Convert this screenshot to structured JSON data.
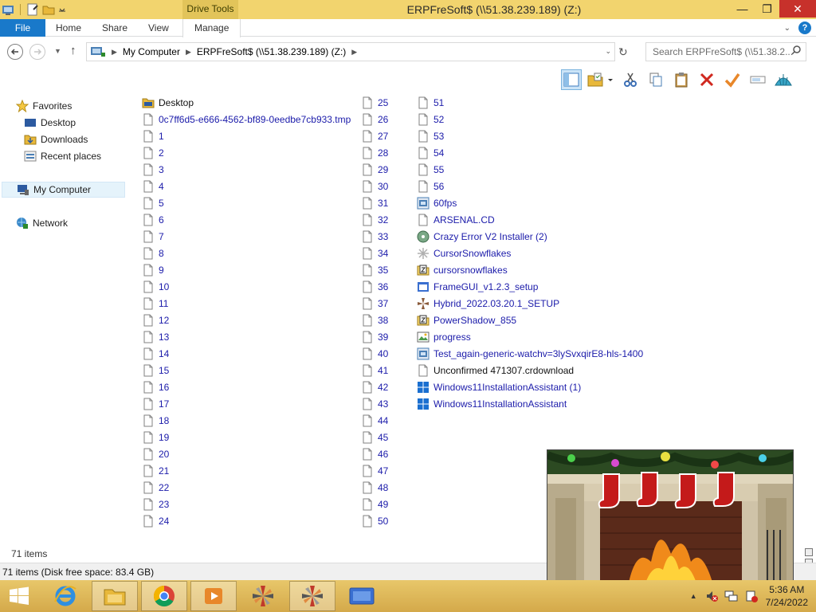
{
  "window": {
    "title": "ERPFreSoft$ (\\\\51.38.239.189) (Z:)",
    "context_tab": "Drive Tools",
    "controls": {
      "minimize": "—",
      "maximize": "❐",
      "close": "✕"
    }
  },
  "ribbon": {
    "tabs": [
      "File",
      "Home",
      "Share",
      "View",
      "Manage"
    ]
  },
  "address_bar": {
    "crumbs": [
      "My Computer",
      "ERPFreSoft$ (\\\\51.38.239.189) (Z:)"
    ],
    "search_placeholder": "Search ERPFreSoft$ (\\\\51.38.2..."
  },
  "nav_pane": {
    "favorites": "Favorites",
    "desktop": "Desktop",
    "downloads": "Downloads",
    "recent": "Recent places",
    "computer": "My Computer",
    "network": "Network"
  },
  "files": {
    "col1": [
      "Desktop",
      "0c7ff6d5-e666-4562-bf89-0eedbe7cb933.tmp",
      "1",
      "2",
      "3",
      "4",
      "5",
      "6",
      "7",
      "8",
      "9",
      "10",
      "11",
      "12",
      "13",
      "14",
      "15",
      "16",
      "17",
      "18",
      "19",
      "20",
      "21",
      "22",
      "23",
      "24"
    ],
    "col2": [
      "25",
      "26",
      "27",
      "28",
      "29",
      "30",
      "31",
      "32",
      "33",
      "34",
      "35",
      "36",
      "37",
      "38",
      "39",
      "40",
      "41",
      "42",
      "43",
      "44",
      "45",
      "46",
      "47",
      "48",
      "49",
      "50"
    ],
    "col3": [
      "51",
      "52",
      "53",
      "54",
      "55",
      "56",
      "60fps",
      "ARSENAL.CD",
      "Crazy Error V2 Installer (2)",
      "CursorSnowflakes",
      "cursorsnowflakes",
      "FrameGUI_v1.2.3_setup",
      "Hybrid_2022.03.20.1_SETUP",
      "PowerShadow_855",
      "progress",
      "Test_again-generic-watchv=3lySvxqirE8-hls-1400",
      "Unconfirmed 471307.crdownload",
      "Windows11InstallationAssistant (1)",
      "Windows11InstallationAssistant"
    ]
  },
  "status": {
    "items_count": "71 items",
    "status_bar": "71 items (Disk free space: 83.4 GB)"
  },
  "taskbar": {
    "time": "5:36 AM",
    "date": "7/24/2022"
  },
  "colors": {
    "title_bar": "#f2d46e",
    "file_tab": "#1979ca",
    "link_text": "#1b1baa",
    "close_button": "#c7312b"
  }
}
